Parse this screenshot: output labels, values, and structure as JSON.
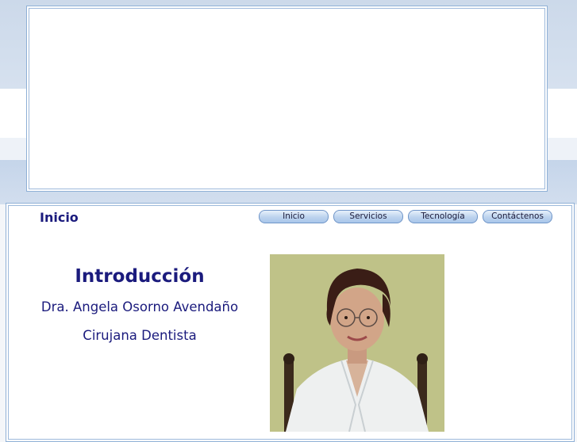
{
  "page": {
    "title": "Inicio"
  },
  "nav": {
    "items": [
      {
        "label": "Inicio"
      },
      {
        "label": "Servicios"
      },
      {
        "label": "Tecnología"
      },
      {
        "label": "Contáctenos"
      }
    ]
  },
  "intro": {
    "heading": "Introducción",
    "name": "Dra. Angela Osorno Avendaño",
    "profession": "Cirujana Dentista"
  },
  "photo": {
    "subject": "portrait of dentist in white coat"
  },
  "colors": {
    "heading_text": "#1b1b7d",
    "border": "#8fb0d6",
    "nav_button": "#bcd3ee"
  }
}
